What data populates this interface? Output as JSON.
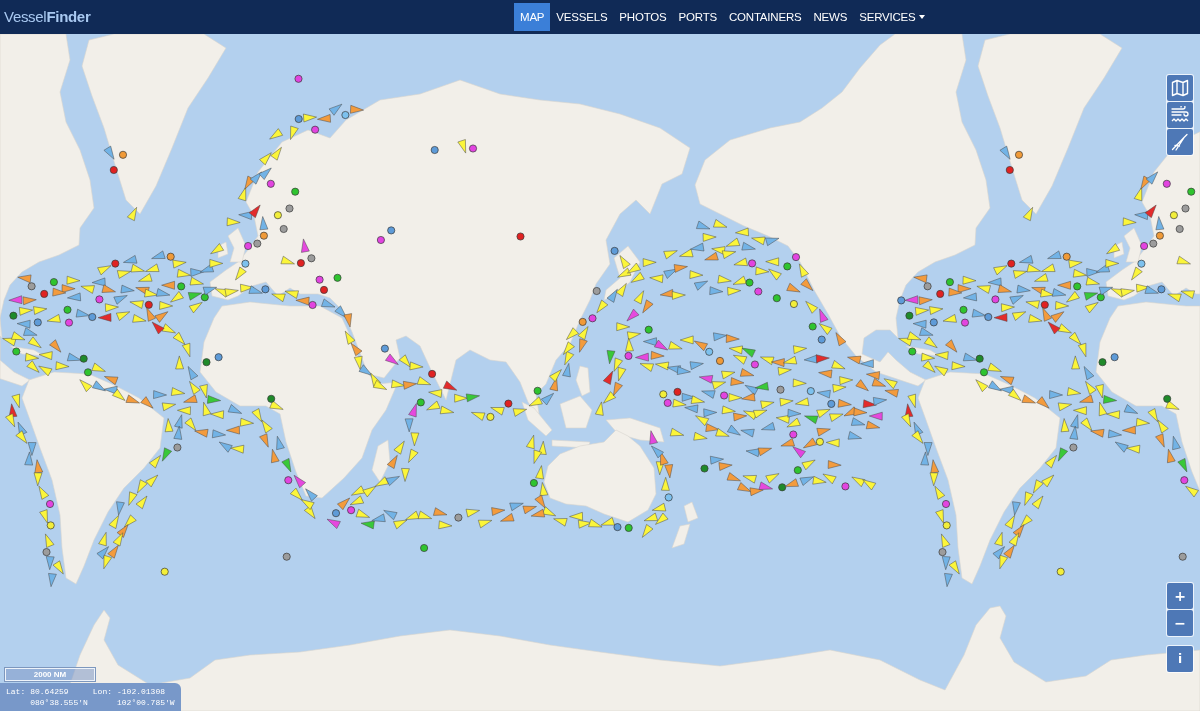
{
  "header": {
    "logo": "Vessel**Finder**",
    "nav": [
      {
        "label": "MAP",
        "selected": true,
        "kind": "link"
      },
      {
        "label": "VESSELS",
        "selected": false,
        "kind": "link"
      },
      {
        "label": "PHOTOS",
        "selected": false,
        "kind": "link"
      },
      {
        "label": "PORTS",
        "selected": false,
        "kind": "link"
      },
      {
        "label": "CONTAINERS",
        "selected": false,
        "kind": "link"
      },
      {
        "label": "NEWS",
        "selected": false,
        "kind": "link"
      },
      {
        "label": "SERVICES",
        "selected": false,
        "kind": "menu"
      }
    ]
  },
  "map_controls": {
    "zoom_in": "+",
    "zoom_out": "−",
    "info": "i"
  },
  "scale": "2000 NM",
  "coordinates": {
    "lat_label": "Lat:",
    "lat": "80.64259",
    "lon_label": "Lon:",
    "lon": "-102.01308",
    "lat_dms": "080°38.555'N",
    "lon_dms": "102°00.785'W"
  }
}
